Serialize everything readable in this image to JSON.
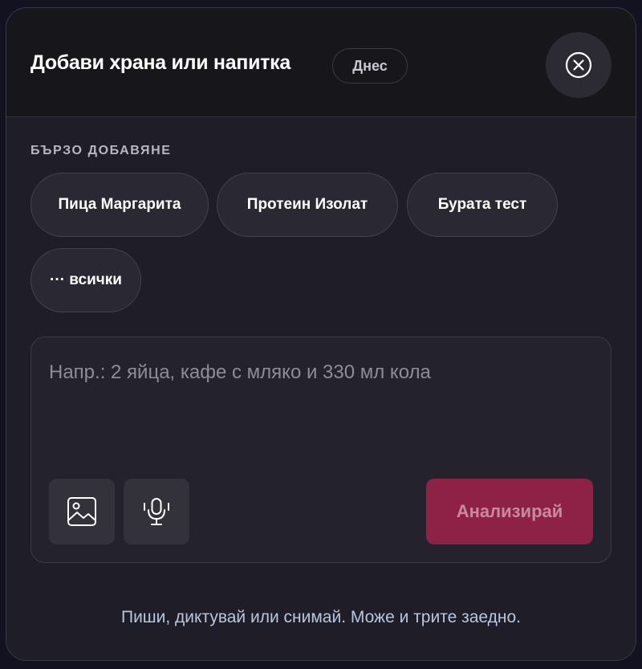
{
  "header": {
    "title": "Добави храна или напитка",
    "date_badge": "Днес",
    "close_icon": "close-circle-icon"
  },
  "quick_add": {
    "label": "БЪРЗО ДОБАВЯНЕ",
    "items": [
      {
        "label": "Пица Маргарита"
      },
      {
        "label": "Протеин Изолат"
      },
      {
        "label": "Бурата тест"
      },
      {
        "label": "··· всички"
      }
    ]
  },
  "input": {
    "placeholder": "Напр.: 2 яйца, кафе с мляко и 330 мл кола",
    "value": "",
    "image_icon": "image-icon",
    "mic_icon": "microphone-icon",
    "analyze_label": "Анализирай"
  },
  "hint": "Пиши, диктувай или снимай. Може и трите заедно.",
  "colors": {
    "background": "#121221",
    "modal": "#1f1d28",
    "header": "#17161b",
    "accent": "#8d2146",
    "hint_text": "#b8c7de"
  }
}
